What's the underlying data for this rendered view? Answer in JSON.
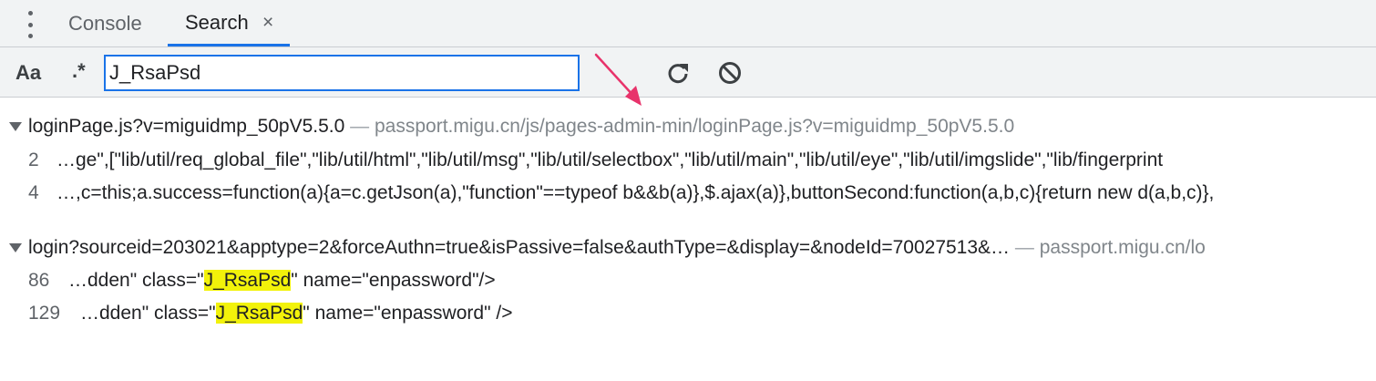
{
  "tabs": {
    "console_label": "Console",
    "search_label": "Search",
    "close_glyph": "×"
  },
  "toolbar": {
    "match_case_label": "Aa",
    "regex_label": ".*",
    "search_value": "J_RsaPsd"
  },
  "icons": {
    "menu": "kebab-menu-icon",
    "refresh": "refresh-icon",
    "clear": "clear-icon",
    "collapse": "triangle-down-icon"
  },
  "colors": {
    "accent": "#1a73e8",
    "highlight": "#f2f20a",
    "annotation_arrow": "#e8336b"
  },
  "results": [
    {
      "file": "loginPage.js?v=miguidmp_50pV5.5.0",
      "separator": " — ",
      "url": "passport.migu.cn/js/pages-admin-min/loginPage.js?v=miguidmp_50pV5.5.0",
      "matches": [
        {
          "line": "2",
          "text_before": "…ge\",[\"lib/util/req_global_file\",\"lib/util/html\",\"lib/util/msg\",\"lib/util/selectbox\",\"lib/util/main\",\"lib/util/eye\",\"lib/util/imgslide\",\"lib/fingerprint",
          "highlight": "",
          "text_after": ""
        },
        {
          "line": "4",
          "text_before": "…,c=this;a.success=function(a){a=c.getJson(a),\"function\"==typeof b&&b(a)},$.ajax(a)},buttonSecond:function(a,b,c){return new d(a,b,c)},",
          "highlight": "",
          "text_after": ""
        }
      ]
    },
    {
      "file": "login?sourceid=203021&apptype=2&forceAuthn=true&isPassive=false&authType=&display=&nodeId=70027513&…",
      "separator": " — ",
      "url": "passport.migu.cn/lo",
      "matches": [
        {
          "line": "86",
          "text_before": "…dden\" class=\"",
          "highlight": "J_RsaPsd",
          "text_after": "\" name=\"enpassword\"/>"
        },
        {
          "line": "129",
          "text_before": "…dden\" class=\"",
          "highlight": "J_RsaPsd",
          "text_after": "\" name=\"enpassword\" />"
        }
      ]
    }
  ]
}
